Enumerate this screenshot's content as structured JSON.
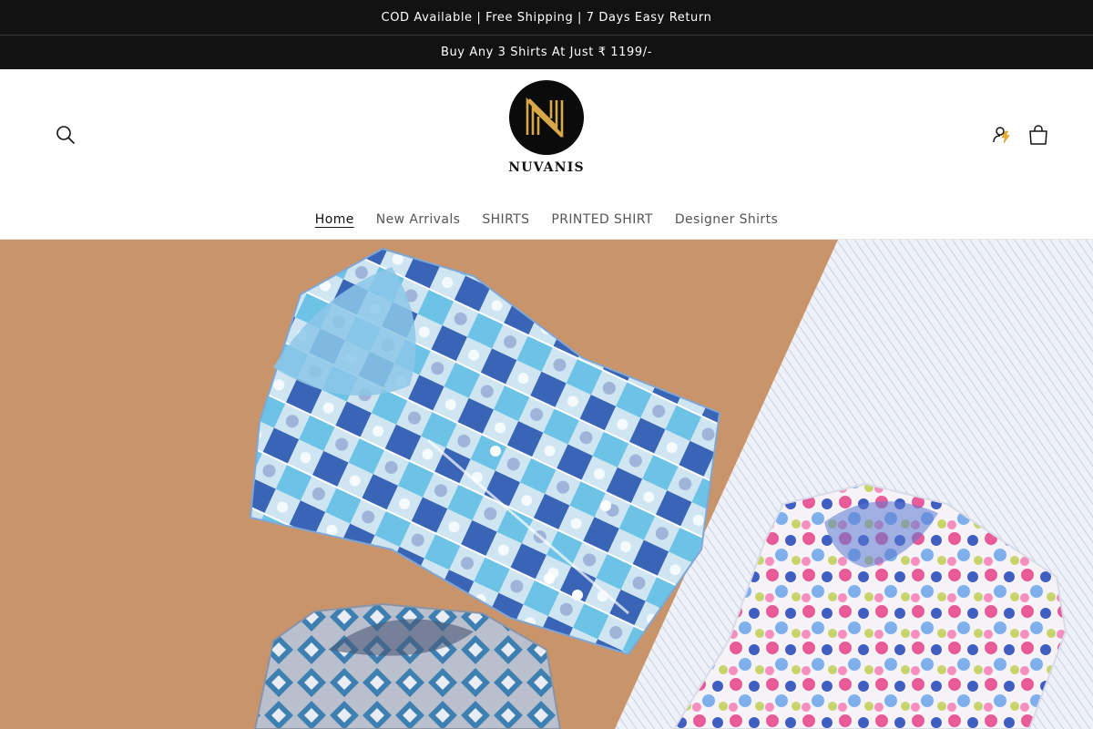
{
  "announcements": [
    {
      "text": "COD Available | Free Shipping | 7 Days Easy Return"
    },
    {
      "text": "Buy Any 3 Shirts At Just ₹ 1199/-"
    }
  ],
  "header": {
    "brand": "NUVANIS",
    "icons": {
      "search": "search-icon",
      "account": "account-icon",
      "cart": "cart-icon"
    }
  },
  "nav": {
    "items": [
      {
        "label": "Home",
        "active": true
      },
      {
        "label": "New Arrivals"
      },
      {
        "label": "SHIRTS"
      },
      {
        "label": "PRINTED SHIRT"
      },
      {
        "label": "Designer Shirts"
      }
    ]
  },
  "hero": {
    "colors": {
      "background_left": "#c9946a",
      "background_right": "#e9edf5",
      "shirt_main": "#a9d8ee",
      "shirt_floral": "#e85c9a",
      "shirt_bottom": "#6f7d93"
    }
  }
}
